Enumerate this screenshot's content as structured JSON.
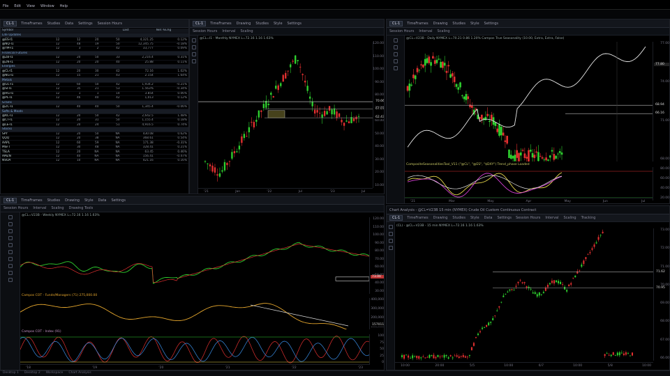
{
  "app": {
    "title": "",
    "menu": [
      "File",
      "Edit",
      "View",
      "Window",
      "Help"
    ]
  },
  "colors": {
    "up": "#2fd12f",
    "down": "#e23030",
    "bg": "#000000",
    "yellow": "#e8d84a",
    "magenta": "#d63fd6",
    "orange": "#e6a72d",
    "blue": "#3a8fe8",
    "white": "#e8e8e8"
  },
  "watchlist": {
    "toolbar": {
      "sym": "CL-1",
      "items": [
        "TimeFrames",
        "Studies",
        "Data",
        "Settings",
        "Session Hours"
      ]
    },
    "headers": [
      "Symbol",
      "",
      "",
      "",
      "",
      "Last",
      "Net %Chg"
    ],
    "rows": [
      {
        "sec": "Lite Updates"
      },
      {
        "s": "@ES-I1",
        "a": "12",
        "b": "12",
        "c": "20",
        "d": "50",
        "e": "4,321.25",
        "f": "0.12%",
        "neg": false
      },
      {
        "s": "@NQ-I1",
        "a": "12",
        "b": "48",
        "c": "19",
        "d": "50",
        "e": "12,345.75",
        "f": "-0.18%",
        "neg": true
      },
      {
        "s": "@YM-I1",
        "a": "12",
        "b": "3",
        "c": "2",
        "d": "42",
        "e": "33,777",
        "f": "0.09%",
        "neg": false
      },
      {
        "sec": "Financial Futures"
      },
      {
        "s": "@ZB-I1",
        "a": "12",
        "b": "20",
        "c": "50",
        "d": "33",
        "e": "2,216.4",
        "f": "0.31%",
        "neg": false
      },
      {
        "s": "@ZN-I1",
        "a": "12",
        "b": "20",
        "c": "20",
        "d": "40",
        "e": "25.88",
        "f": "0.11%",
        "neg": false
      },
      {
        "sec": "Energies"
      },
      {
        "s": "@CL-I1",
        "a": "12",
        "b": "20",
        "c": "30",
        "d": "42",
        "e": "72.16",
        "f": "1.02%",
        "neg": false
      },
      {
        "s": "@NG-I1",
        "a": "12",
        "b": "15",
        "c": "21",
        "d": "43",
        "e": "2.154",
        "f": "1.64%",
        "neg": false
      },
      {
        "sec": "Metals"
      },
      {
        "s": "@GC-I1",
        "a": "12",
        "b": "60",
        "c": "50",
        "d": "42",
        "e": "1,934.2",
        "f": "-0.21%",
        "neg": true
      },
      {
        "s": "@SI-I1",
        "a": "12",
        "b": "35",
        "c": "21",
        "d": "53",
        "e": "1.563%",
        "f": "-0.34%",
        "neg": true
      },
      {
        "s": "@HG-I1",
        "a": "12",
        "b": "1",
        "c": "1",
        "d": "14",
        "e": "3.854",
        "f": "0.06%",
        "neg": false
      },
      {
        "s": "@PL-I1",
        "a": "12",
        "b": "46",
        "c": "40",
        "d": "42",
        "e": "1,013",
        "f": "0.12%",
        "neg": false
      },
      {
        "sec": "Grains"
      },
      {
        "s": "@ZC-I1",
        "a": "12",
        "b": "40",
        "c": "40",
        "d": "50",
        "e": "1,345.4",
        "f": "-0.06%",
        "neg": true
      },
      {
        "sec": "Softs & Meats"
      },
      {
        "s": "@KC-I1",
        "a": "12",
        "b": "20",
        "c": "50",
        "d": "42",
        "e": "2,642.5",
        "f": "1.48%",
        "neg": false
      },
      {
        "s": "@CT-I1",
        "a": "12",
        "b": "20",
        "c": "31",
        "d": "50",
        "e": "1,155.4",
        "f": "0.18%",
        "neg": false
      },
      {
        "s": "@LE-I1",
        "a": "12",
        "b": "20",
        "c": "24",
        "d": "51",
        "e": "4,916.5",
        "f": "0.74%",
        "neg": false
      },
      {
        "sec": "Stocks"
      },
      {
        "s": "SPY",
        "a": "12",
        "b": "20",
        "c": "50",
        "d": "NA",
        "e": "430.08",
        "f": "0.62%",
        "neg": false
      },
      {
        "s": "QQQ",
        "a": "12",
        "b": "20",
        "c": "38",
        "d": "NA",
        "e": "368.61",
        "f": "0.54%",
        "neg": false
      },
      {
        "s": "AAPL",
        "a": "12",
        "b": "60",
        "c": "59",
        "d": "NA",
        "e": "171.38",
        "f": "-0.31%",
        "neg": true
      },
      {
        "s": "MSFT",
        "a": "12",
        "b": "30",
        "c": "48",
        "d": "NA",
        "e": "328.41",
        "f": "0.21%",
        "neg": false
      },
      {
        "s": "TSLA",
        "a": "12",
        "b": "20",
        "c": "NA",
        "d": "NA",
        "e": "63.45",
        "f": "0.46%",
        "neg": false
      },
      {
        "s": "AMZN",
        "a": "12",
        "b": "40",
        "c": "NA",
        "d": "NA",
        "e": "156.41",
        "f": "-0.47%",
        "neg": true
      },
      {
        "s": "NVDA",
        "a": "12",
        "b": "10",
        "c": "NA",
        "d": "NA",
        "e": "421.16",
        "f": "0.16%",
        "neg": false
      }
    ]
  },
  "chart1": {
    "toolbar": {
      "sym": "CL-1",
      "items": [
        "TimeFrames",
        "Drawing",
        "Studies",
        "Style",
        "Settings"
      ]
    },
    "toolbar2": [
      "Session Hours",
      "Interval",
      "Scaling"
    ],
    "info": "@CL=I1 - Monthly NYMEX L=72.16 1.16 1.63%",
    "yticks": [
      "120.00",
      "110.00",
      "100.00",
      "90.00",
      "80.00",
      "70.00",
      "60.00",
      "50.00",
      "40.00",
      "30.00",
      "20.00",
      "10.00"
    ],
    "xticks": [
      "'21",
      "Jan",
      "'22",
      "Jul",
      "'23",
      "Jul"
    ],
    "levels": [
      {
        "v": "70.66",
        "y": 0.41
      },
      {
        "v": "67.07",
        "y": 0.46
      },
      {
        "v": "62.43",
        "y": 0.52
      }
    ]
  },
  "chart2": {
    "toolbar": {
      "sym": "CL-1",
      "items": [
        "TimeFrames",
        "Drawing",
        "Studies",
        "Style",
        "Settings"
      ]
    },
    "toolbar2": [
      "Session Hours",
      "Interval",
      "Scaling"
    ],
    "info": "@CL=V23B - Daily NYMEX L=70.21 0.86 1.20%   Campos True Seasonality (10.00, Extra, Extra, False)",
    "tag": "77.80",
    "yticks": [
      "77.00",
      "74.00",
      "71.00",
      "68.00"
    ],
    "levels": [
      {
        "v": "68.94",
        "y": 0.53
      },
      {
        "v": "66.16",
        "y": 0.6
      }
    ],
    "osc_info": "CompositeSeasonalitiesTool_V11 (\"@CL\", \"@ES\", \"$DXY\")  Trend_phase  Loaded",
    "osc_yticks": [
      "80.00",
      "60.00",
      "40.00",
      "20.00"
    ],
    "xticks": [
      "'21",
      "Mar",
      "May",
      "Apr",
      "May",
      "Jun",
      "Jul"
    ]
  },
  "chart3": {
    "toolbar": {
      "sym": "CL-1",
      "items": [
        "TimeFrames",
        "Studies",
        "Drawing",
        "Style",
        "Data",
        "Settings"
      ]
    },
    "toolbar2": [
      "Session Hours",
      "Interval",
      "Scaling",
      "Drawing Tools"
    ],
    "info": "@CL=V23B - Weekly NYMEX L=72.16 1.16 1.63%",
    "yticks": [
      "120.00",
      "110.00",
      "100.00",
      "90.00",
      "80.00",
      "70.00",
      "60.00",
      "50.00",
      "40.00",
      "30.00"
    ],
    "tag": "73.00",
    "cot_info": "Campos COT - Funds/Managers (71)  275,000.00",
    "cot_yticks": [
      "400,000",
      "300,000",
      "200,000",
      "100,000"
    ],
    "cot_tag": "157011.12",
    "ind_info": "Campos COT - Index (91)",
    "ind_yticks": [
      "100",
      "75",
      "50",
      "25",
      "0"
    ],
    "xticks": [
      "'18",
      "'19",
      "'20",
      "'21",
      "'22",
      "'23"
    ]
  },
  "chart4": {
    "header": "Chart Analysis - @CL=V23B 15 min (NYMEX) Crude Oil Custom Continuous Contract",
    "toolbar": {
      "sym": "CL-1",
      "items": [
        "TimeFrames",
        "Drawing",
        "Studies",
        "Style",
        "Data",
        "Settings"
      ]
    },
    "toolbar2": [
      "Session Hours",
      "Interval",
      "Scaling",
      "Tracking"
    ],
    "info": "(CL) - @CL=V23B - 15 min NYMEX L=72.16 1.16 1.63%",
    "yticks": [
      "73.00",
      "72.00",
      "71.00",
      "70.00",
      "69.00",
      "68.00",
      "67.00",
      "66.00"
    ],
    "levels": [
      {
        "v": "71.62",
        "y": 0.33
      },
      {
        "v": "70.95",
        "y": 0.45
      }
    ],
    "xticks": [
      "10:00",
      "20:00",
      "5/5",
      "10:00",
      "6/7",
      "10:00",
      "5/8",
      "10:00"
    ]
  },
  "status": [
    "Desktop 1",
    "Desktop 2",
    "Workspace",
    "Chart Analysis"
  ]
}
